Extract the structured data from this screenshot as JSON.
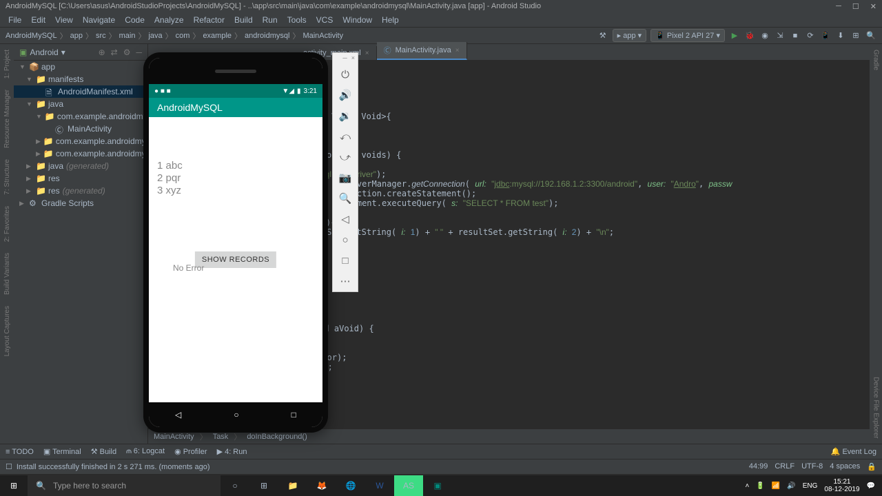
{
  "window": {
    "title": "AndroidMySQL [C:\\Users\\asus\\AndroidStudioProjects\\AndroidMySQL] - ..\\app\\src\\main\\java\\com\\example\\androidmysql\\MainActivity.java [app] - Android Studio"
  },
  "menu": [
    "File",
    "Edit",
    "View",
    "Navigate",
    "Code",
    "Analyze",
    "Refactor",
    "Build",
    "Run",
    "Tools",
    "VCS",
    "Window",
    "Help"
  ],
  "breadcrumb": [
    "AndroidMySQL",
    "app",
    "src",
    "main",
    "java",
    "com",
    "example",
    "androidmysql",
    "MainActivity"
  ],
  "toolbar": {
    "config": "app",
    "device": "Pixel 2 API 27"
  },
  "left_tools": [
    "1: Project",
    "Resource Manager",
    "7: Structure",
    "2: Favorites",
    "Build Variants",
    "Layout Captures"
  ],
  "right_tools": [
    "Gradle",
    "Device File Explorer"
  ],
  "tree": {
    "header": "Android",
    "items": [
      {
        "depth": 0,
        "arr": "▼",
        "ico": "📦",
        "label": "app"
      },
      {
        "depth": 1,
        "arr": "▼",
        "ico": "📁",
        "label": "manifests"
      },
      {
        "depth": 2,
        "arr": "",
        "ico": "🗎",
        "label": "AndroidManifest.xml",
        "sel": true
      },
      {
        "depth": 1,
        "arr": "▼",
        "ico": "📁",
        "label": "java"
      },
      {
        "depth": 2,
        "arr": "▼",
        "ico": "📁",
        "label": "com.example.androidmysql"
      },
      {
        "depth": 3,
        "arr": "",
        "ico": "Ⓒ",
        "label": "MainActivity"
      },
      {
        "depth": 2,
        "arr": "▶",
        "ico": "📁",
        "label": "com.example.androidmysql"
      },
      {
        "depth": 2,
        "arr": "▶",
        "ico": "📁",
        "label": "com.example.androidmysql"
      },
      {
        "depth": 1,
        "arr": "▶",
        "ico": "📁",
        "label": "java",
        "gen": "(generated)"
      },
      {
        "depth": 1,
        "arr": "▶",
        "ico": "📁",
        "label": "res"
      },
      {
        "depth": 1,
        "arr": "▶",
        "ico": "📁",
        "label": "res",
        "gen": "(generated)"
      },
      {
        "depth": 0,
        "arr": "▶",
        "ico": "⚙",
        "label": "Gradle Scripts"
      }
    ]
  },
  "tabs": [
    {
      "label": "activity_main.xml",
      "active": false
    },
    {
      "label": "MainActivity.java",
      "active": true
    }
  ],
  "code_crumb": [
    "MainActivity",
    "Task",
    "doInBackground()"
  ],
  "bottom_tabs": [
    "≡ TODO",
    "▣ Terminal",
    "⚒ Build",
    "⫙ 6: Logcat",
    "◉ Profiler",
    "▶ 4: Run"
  ],
  "event_log": "Event Log",
  "status": {
    "msg": "Install successfully finished in 2 s 271 ms. (moments ago)",
    "pos": "44:99",
    "eol": "CRLF",
    "enc": "UTF-8",
    "indent": "4 spaces"
  },
  "emulator": {
    "time": "3:21",
    "app_title": "AndroidMySQL",
    "records": [
      "1 abc",
      "2 pqr",
      "3 xyz"
    ],
    "button": "SHOW RECORDS",
    "error": "No Error"
  },
  "taskbar": {
    "search": "Type here to search",
    "clock_time": "15:21",
    "clock_date": "08-12-2019",
    "lang": "ENG"
  }
}
